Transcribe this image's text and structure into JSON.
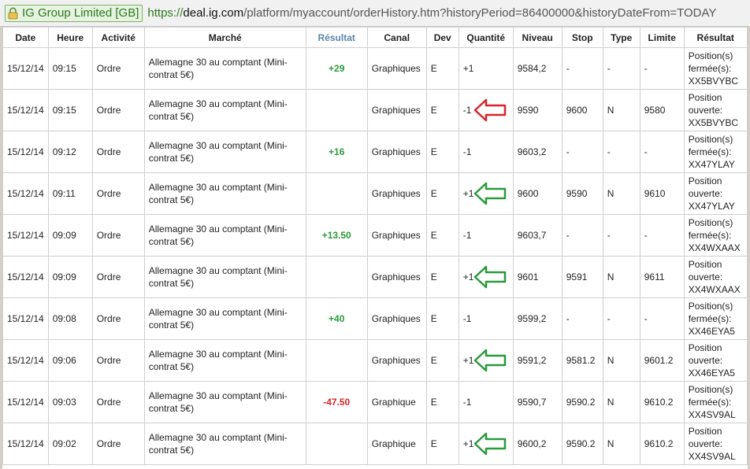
{
  "addressbar": {
    "site_identity": "IG Group Limited [GB]",
    "scheme": "https://",
    "host": "deal.ig.com",
    "path": "/platform/myaccount/orderHistory.htm?historyPeriod=86400000&historyDateFrom=TODAY"
  },
  "table": {
    "headers": [
      "Date",
      "Heure",
      "Activité",
      "Marché",
      "Résultat",
      "Canal",
      "Dev",
      "Quantité",
      "Niveau",
      "Stop",
      "Type",
      "Limite",
      "Résultat"
    ],
    "rows": [
      {
        "date": "15/12/14",
        "heure": "09:15",
        "activite": "Ordre",
        "marche": "Allemagne 30 au comptant (Mini-contrat 5€)",
        "resultat": "+29",
        "canal": "Graphiques",
        "dev": "E",
        "quantite": "+1",
        "niveau": "9584,2",
        "stop": "-",
        "type": "-",
        "limite": "-",
        "resultat_detail": "Position(s) fermée(s): XX5BVYBC",
        "arrow": ""
      },
      {
        "date": "15/12/14",
        "heure": "09:15",
        "activite": "Ordre",
        "marche": "Allemagne 30 au comptant (Mini-contrat 5€)",
        "resultat": "",
        "canal": "Graphiques",
        "dev": "E",
        "quantite": "-1",
        "niveau": "9590",
        "stop": "9600",
        "type": "N",
        "limite": "9580",
        "resultat_detail": "Position ouverte: XX5BVYBC",
        "arrow": "red"
      },
      {
        "date": "15/12/14",
        "heure": "09:12",
        "activite": "Ordre",
        "marche": "Allemagne 30 au comptant (Mini-contrat 5€)",
        "resultat": "+16",
        "canal": "Graphiques",
        "dev": "E",
        "quantite": "-1",
        "niveau": "9603,2",
        "stop": "-",
        "type": "-",
        "limite": "-",
        "resultat_detail": "Position(s) fermée(s): XX47YLAY",
        "arrow": ""
      },
      {
        "date": "15/12/14",
        "heure": "09:11",
        "activite": "Ordre",
        "marche": "Allemagne 30 au comptant (Mini-contrat 5€)",
        "resultat": "",
        "canal": "Graphiques",
        "dev": "E",
        "quantite": "+1",
        "niveau": "9600",
        "stop": "9590",
        "type": "N",
        "limite": "9610",
        "resultat_detail": "Position ouverte: XX47YLAY",
        "arrow": "green"
      },
      {
        "date": "15/12/14",
        "heure": "09:09",
        "activite": "Ordre",
        "marche": "Allemagne 30 au comptant (Mini-contrat 5€)",
        "resultat": "+13.50",
        "canal": "Graphiques",
        "dev": "E",
        "quantite": "-1",
        "niveau": "9603,7",
        "stop": "-",
        "type": "-",
        "limite": "-",
        "resultat_detail": "Position(s) fermée(s): XX4WXAAX",
        "arrow": ""
      },
      {
        "date": "15/12/14",
        "heure": "09:09",
        "activite": "Ordre",
        "marche": "Allemagne 30 au comptant (Mini-contrat 5€)",
        "resultat": "",
        "canal": "Graphiques",
        "dev": "E",
        "quantite": "+1",
        "niveau": "9601",
        "stop": "9591",
        "type": "N",
        "limite": "9611",
        "resultat_detail": "Position ouverte: XX4WXAAX",
        "arrow": "green"
      },
      {
        "date": "15/12/14",
        "heure": "09:08",
        "activite": "Ordre",
        "marche": "Allemagne 30 au comptant (Mini-contrat 5€)",
        "resultat": "+40",
        "canal": "Graphiques",
        "dev": "E",
        "quantite": "-1",
        "niveau": "9599,2",
        "stop": "-",
        "type": "-",
        "limite": "-",
        "resultat_detail": "Position(s) fermée(s): XX46EYA5",
        "arrow": ""
      },
      {
        "date": "15/12/14",
        "heure": "09:06",
        "activite": "Ordre",
        "marche": "Allemagne 30 au comptant (Mini-contrat 5€)",
        "resultat": "",
        "canal": "Graphiques",
        "dev": "E",
        "quantite": "+1",
        "niveau": "9591,2",
        "stop": "9581.2",
        "type": "N",
        "limite": "9601.2",
        "resultat_detail": "Position ouverte: XX46EYA5",
        "arrow": "green"
      },
      {
        "date": "15/12/14",
        "heure": "09:03",
        "activite": "Ordre",
        "marche": "Allemagne 30 au comptant (Mini-contrat 5€)",
        "resultat": "-47.50",
        "canal": "Graphique",
        "dev": "E",
        "quantite": "-1",
        "niveau": "9590,7",
        "stop": "9590.2",
        "type": "N",
        "limite": "9610.2",
        "resultat_detail": "Position(s) fermée(s): XX4SV9AL",
        "arrow": ""
      },
      {
        "date": "15/12/14",
        "heure": "09:02",
        "activite": "Ordre",
        "marche": "Allemagne 30 au comptant (Mini-contrat 5€)",
        "resultat": "",
        "canal": "Graphique",
        "dev": "E",
        "quantite": "+1",
        "niveau": "9600,2",
        "stop": "9590.2",
        "type": "N",
        "limite": "9610.2",
        "resultat_detail": "Position ouverte: XX4SV9AL",
        "arrow": "green"
      }
    ]
  },
  "colors": {
    "positive": "#2a9a3c",
    "negative": "#d6262b",
    "arrow_green": "#2a9a3c",
    "arrow_red": "#d6262b",
    "sorted_header": "#5b86ad"
  }
}
